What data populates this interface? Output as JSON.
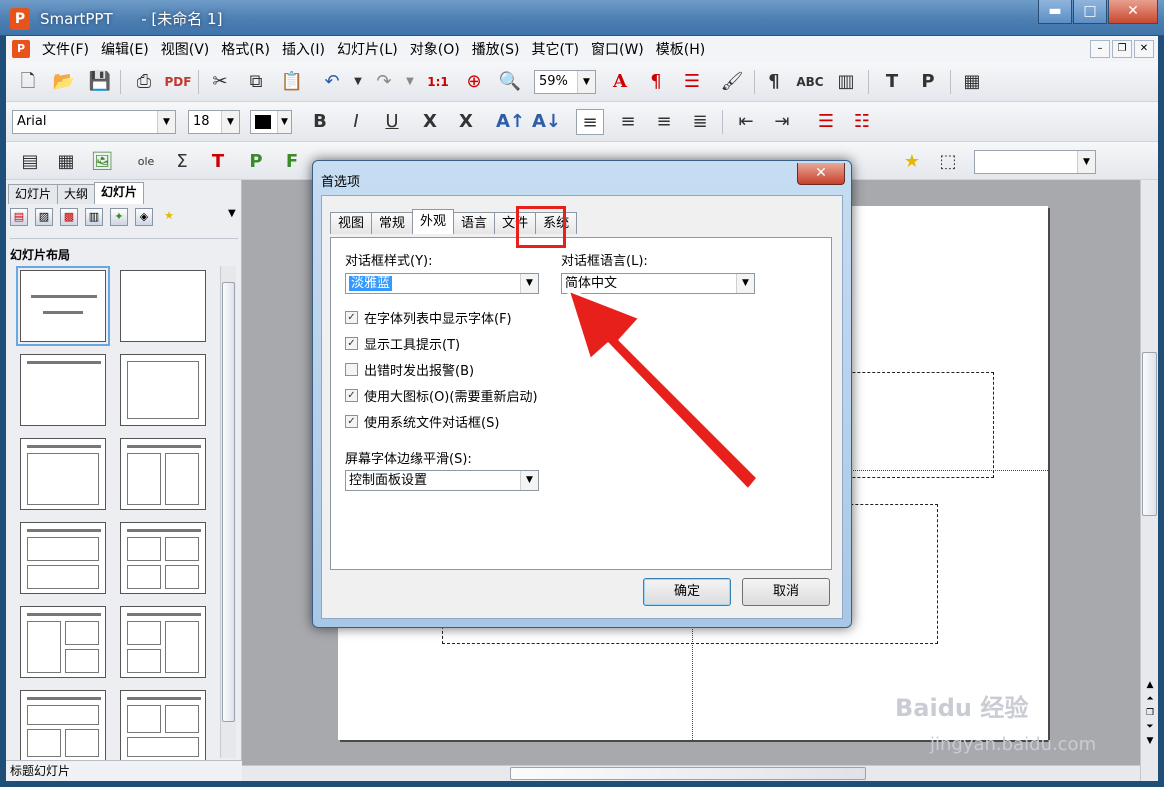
{
  "window": {
    "title": "SmartPPT      - [未命名 1]",
    "logo": "P",
    "minimize": "▬",
    "maximize": "□",
    "close": "✕"
  },
  "menu": [
    "文件(F)",
    "编辑(E)",
    "视图(V)",
    "格式(R)",
    "插入(I)",
    "幻灯片(L)",
    "对象(O)",
    "播放(S)",
    "其它(T)",
    "窗口(W)",
    "模板(H)"
  ],
  "toolbar": {
    "zoom": "59%",
    "font": "Arial",
    "font_size": "18"
  },
  "left_panel": {
    "tabs": [
      "幻灯片",
      "大纲",
      "幻灯片"
    ],
    "layout_heading": "幻灯片布局",
    "status": "标题幻灯片"
  },
  "dialog": {
    "title": "首选项",
    "close": "✕",
    "tabs": [
      "视图",
      "常规",
      "外观",
      "语言",
      "文件",
      "系统"
    ],
    "active_tab": "外观",
    "dialog_style_label": "对话框样式(Y):",
    "dialog_style_value": "淡雅蓝",
    "dialog_lang_label": "对话框语言(L):",
    "dialog_lang_value": "简体中文",
    "checkboxes": [
      {
        "label": "在字体列表中显示字体(F)",
        "checked": true
      },
      {
        "label": "显示工具提示(T)",
        "checked": true
      },
      {
        "label": "出错时发出报警(B)",
        "checked": false
      },
      {
        "label": "使用大图标(O)(需要重新启动)",
        "checked": true
      },
      {
        "label": "使用系统文件对话框(S)",
        "checked": true
      }
    ],
    "smoothing_label": "屏幕字体边缘平滑(S):",
    "smoothing_value": "控制面板设置",
    "ok": "确定",
    "cancel": "取消"
  },
  "watermark": {
    "brand": "Baidu 经验",
    "url": "jingyan.baidu.com"
  },
  "colors": {
    "highlight": "#e8201c",
    "arrow": "#e8201c",
    "selection": "#3399ff"
  }
}
